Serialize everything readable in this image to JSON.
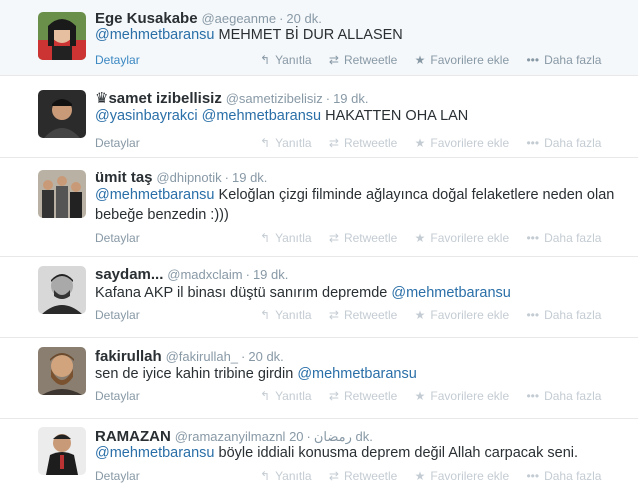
{
  "tweets": [
    {
      "fullname": "Ege Kusakabe",
      "prefix": "",
      "screenname": "@aegeanme",
      "time": "20 dk.",
      "parts": [
        {
          "t": "@mehmetbaransu",
          "m": true
        },
        {
          "t": " MEHMET Bİ DUR ALLASEN",
          "m": false
        }
      ],
      "details": "Detaylar"
    },
    {
      "fullname": "samet izibellisiz",
      "prefix": "♛",
      "screenname": "@sametizibelisiz",
      "time": "19 dk.",
      "parts": [
        {
          "t": "@yasinbayrakci",
          "m": true
        },
        {
          "t": " ",
          "m": false
        },
        {
          "t": "@mehmetbaransu",
          "m": true
        },
        {
          "t": " HAKATTEN OHA LAN",
          "m": false
        }
      ],
      "details": "Detaylar"
    },
    {
      "fullname": "ümit taş",
      "prefix": "",
      "screenname": "@dhipnotik",
      "time": "19 dk.",
      "parts": [
        {
          "t": "@mehmetbaransu",
          "m": true
        },
        {
          "t": " Keloğlan çizgi filminde ağlayınca doğal felaketlere neden olan bebeğe benzedin :)))",
          "m": false
        }
      ],
      "details": "Detaylar"
    },
    {
      "fullname": "saydam...",
      "prefix": "",
      "screenname": "@madxclaim",
      "time": "19 dk.",
      "parts": [
        {
          "t": "Kafana AKP il binası düştü sanırım depremde ",
          "m": false
        },
        {
          "t": "@mehmetbaransu",
          "m": true
        }
      ],
      "details": "Detaylar"
    },
    {
      "fullname": "fakirullah",
      "prefix": "",
      "screenname": "@fakirullah_",
      "time": "20 dk.",
      "parts": [
        {
          "t": "sen de iyice kahin tribine girdin ",
          "m": false
        },
        {
          "t": "@mehmetbaransu",
          "m": true
        }
      ],
      "details": "Detaylar"
    },
    {
      "fullname": "RAMAZAN",
      "prefix": "",
      "screenname": "@ramazanyilmaznl رمضان",
      "time": "20 dk.",
      "parts": [
        {
          "t": "@mehmetbaransu",
          "m": true
        },
        {
          "t": " böyle iddiali konusma deprem değil Allah carpacak seni.",
          "m": false
        }
      ],
      "details": "Detaylar"
    }
  ],
  "actions": {
    "reply": "Yanıtla",
    "retweet": "Retweetle",
    "favorite": "Favorilere ekle",
    "more": "Daha fazla"
  },
  "icons": {
    "reply": "reply-icon",
    "retweet": "retweet-icon",
    "favorite": "star-icon",
    "more": "more-dots-icon"
  },
  "colors": {
    "mention": "#2a6fa8",
    "muted": "#8899a6",
    "text": "#292f33"
  }
}
